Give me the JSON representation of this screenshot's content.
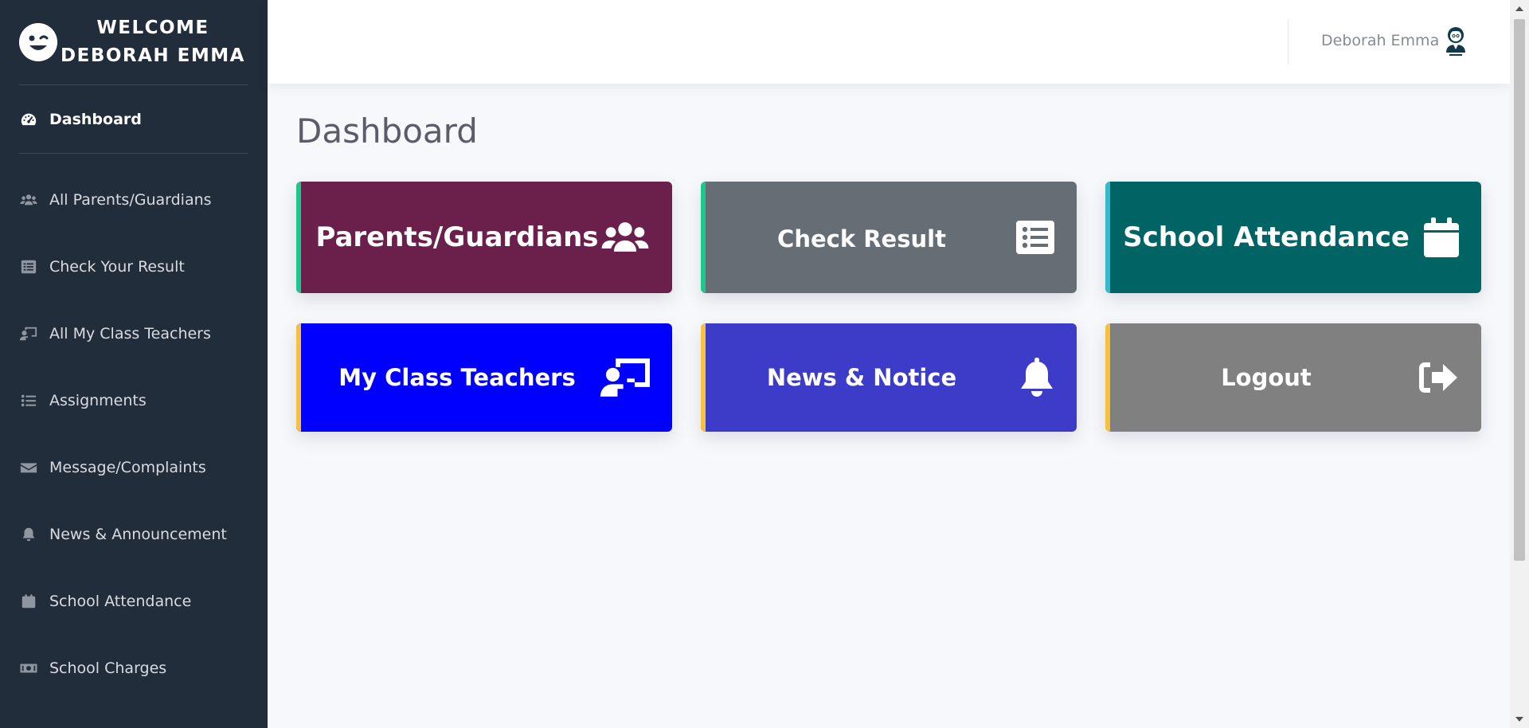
{
  "sidebar": {
    "welcome_line1": "Welcome",
    "welcome_line2": "Deborah Emma",
    "dashboard_label": "Dashboard",
    "items": [
      {
        "label": "All Parents/Guardians",
        "icon": "users-icon"
      },
      {
        "label": "Check Your Result",
        "icon": "list-alt-icon"
      },
      {
        "label": "All My Class Teachers",
        "icon": "chalkboard-teacher-icon"
      },
      {
        "label": "Assignments",
        "icon": "list-icon"
      },
      {
        "label": "Message/Complaints",
        "icon": "envelope-icon"
      },
      {
        "label": "News & Announcement",
        "icon": "bell-icon"
      },
      {
        "label": "School Attendance",
        "icon": "calendar-icon"
      },
      {
        "label": "School Charges",
        "icon": "money-bill-icon"
      }
    ]
  },
  "topbar": {
    "user_name": "Deborah Emma",
    "avatar_icon": "admin-avatar-icon"
  },
  "main": {
    "title": "Dashboard",
    "cards": [
      {
        "label": "Parents/Guardians",
        "bg": "#6b1f4b",
        "stripe": "#1cc88a",
        "icon": "users-icon"
      },
      {
        "label": "Check Result",
        "bg": "#646e74",
        "stripe": "#1cc88a",
        "icon": "list-alt-icon"
      },
      {
        "label": "School Attendance",
        "bg": "#006464",
        "stripe": "#36b9cc",
        "icon": "calendar-icon"
      },
      {
        "label": "My Class Teachers",
        "bg": "#0000ff",
        "stripe": "#f6c23e",
        "icon": "chalkboard-teacher-icon"
      },
      {
        "label": "News & Notice",
        "bg": "#3c3cc8",
        "stripe": "#f6c23e",
        "icon": "bell-icon"
      },
      {
        "label": "Logout",
        "bg": "#808080",
        "stripe": "#f6c23e",
        "icon": "sign-out-icon"
      }
    ]
  },
  "colors": {
    "sidebar_bg": "#222d3b",
    "page_bg": "#f7f8fb"
  }
}
